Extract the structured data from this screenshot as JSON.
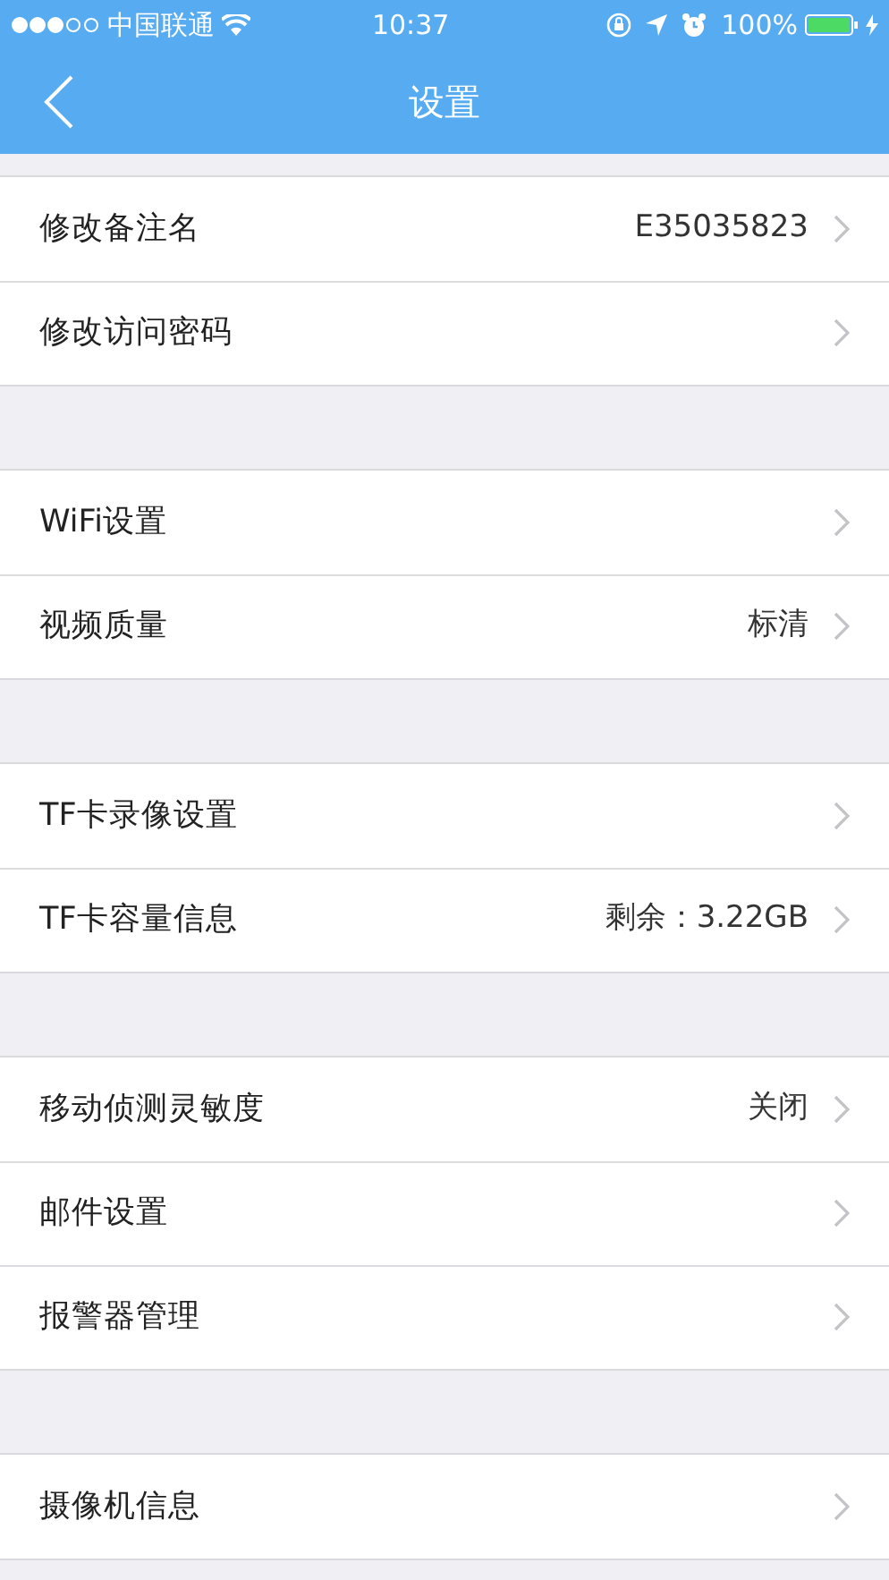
{
  "status_bar": {
    "carrier": "中国联通",
    "time": "10:37",
    "battery_text": "100%"
  },
  "nav": {
    "title": "设置"
  },
  "groups": [
    {
      "rows": [
        {
          "label": "修改备注名",
          "value": "E35035823"
        },
        {
          "label": "修改访问密码"
        }
      ]
    },
    {
      "rows": [
        {
          "label": "WiFi设置"
        },
        {
          "label": "视频质量",
          "value": "标清"
        }
      ]
    },
    {
      "rows": [
        {
          "label": "TF卡录像设置"
        },
        {
          "label": "TF卡容量信息",
          "value": "剩余：3.22GB"
        }
      ]
    },
    {
      "rows": [
        {
          "label": "移动侦测灵敏度",
          "value": "关闭"
        },
        {
          "label": "邮件设置"
        },
        {
          "label": "报警器管理"
        }
      ]
    },
    {
      "rows": [
        {
          "label": "摄像机信息"
        }
      ]
    }
  ]
}
